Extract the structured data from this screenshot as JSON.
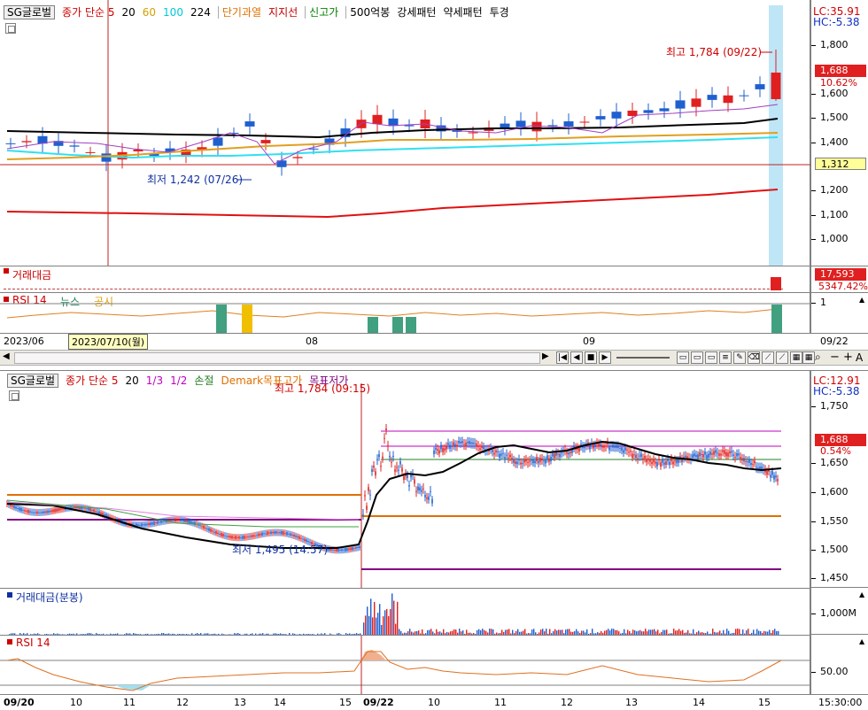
{
  "top": {
    "legend": {
      "symbol": "SG글로벌",
      "ma_label": "종가 단순 5",
      "ma_periods": [
        "20",
        "60",
        "100",
        "224"
      ],
      "items": [
        "단기과열",
        "지지선",
        "신고가",
        "500억봉",
        "강세패턴",
        "약세패턴",
        "투경"
      ]
    },
    "lc": "LC:35.91",
    "hc": "HC:-5.38",
    "price_ticks": [
      "1,800",
      "1,700",
      "1,600",
      "1,500",
      "1,400",
      "1,300",
      "1,200",
      "1,100",
      "1,000"
    ],
    "current_price": "1,688",
    "current_change": "10.62%",
    "line_price": "1,312",
    "high_label": "최고 1,784 (09/22)",
    "low_label": "최저 1,242 (07/26)",
    "volume_label": "거래대금",
    "volume_value": "17,593",
    "volume_change": "5347.42%",
    "rsi_label": "RSI 14",
    "news_label": "뉴스",
    "disclosure_label": "공시",
    "rsi_tick": "1",
    "dates": {
      "start": "2023/06",
      "selected": "2023/07/10(월)",
      "m8": "08",
      "m9": "09",
      "end": "09/22"
    }
  },
  "bottom": {
    "legend": {
      "symbol": "SG글로벌",
      "ma_label": "종가 단순 5",
      "ma_periods": [
        "20"
      ],
      "fractions": [
        "1/3",
        "1/2"
      ],
      "stop": "손절",
      "demark_high": "Demark목표고가",
      "demark_low": "목표저가"
    },
    "lc": "LC:12.91",
    "hc": "HC:-5.38",
    "price_ticks": [
      "1,750",
      "1,700",
      "1,650",
      "1,600",
      "1,550",
      "1,500",
      "1,450"
    ],
    "current_price": "1,688",
    "current_change": "0.54%",
    "high_label": "최고 1,784 (09:15)",
    "low_label": "최저 1,495 (14:57)",
    "volume_label": "거래대금(분봉)",
    "volume_tick": "1,000M",
    "rsi_label": "RSI 14",
    "rsi_tick": "50.00",
    "times": [
      "09/20",
      "10",
      "11",
      "12",
      "13",
      "14",
      "15",
      "09/22",
      "10",
      "11",
      "12",
      "13",
      "14",
      "15",
      "15:30:00"
    ]
  },
  "colors": {
    "up": "#e02020",
    "down": "#1f5fcf",
    "accent": "#ff0000"
  }
}
